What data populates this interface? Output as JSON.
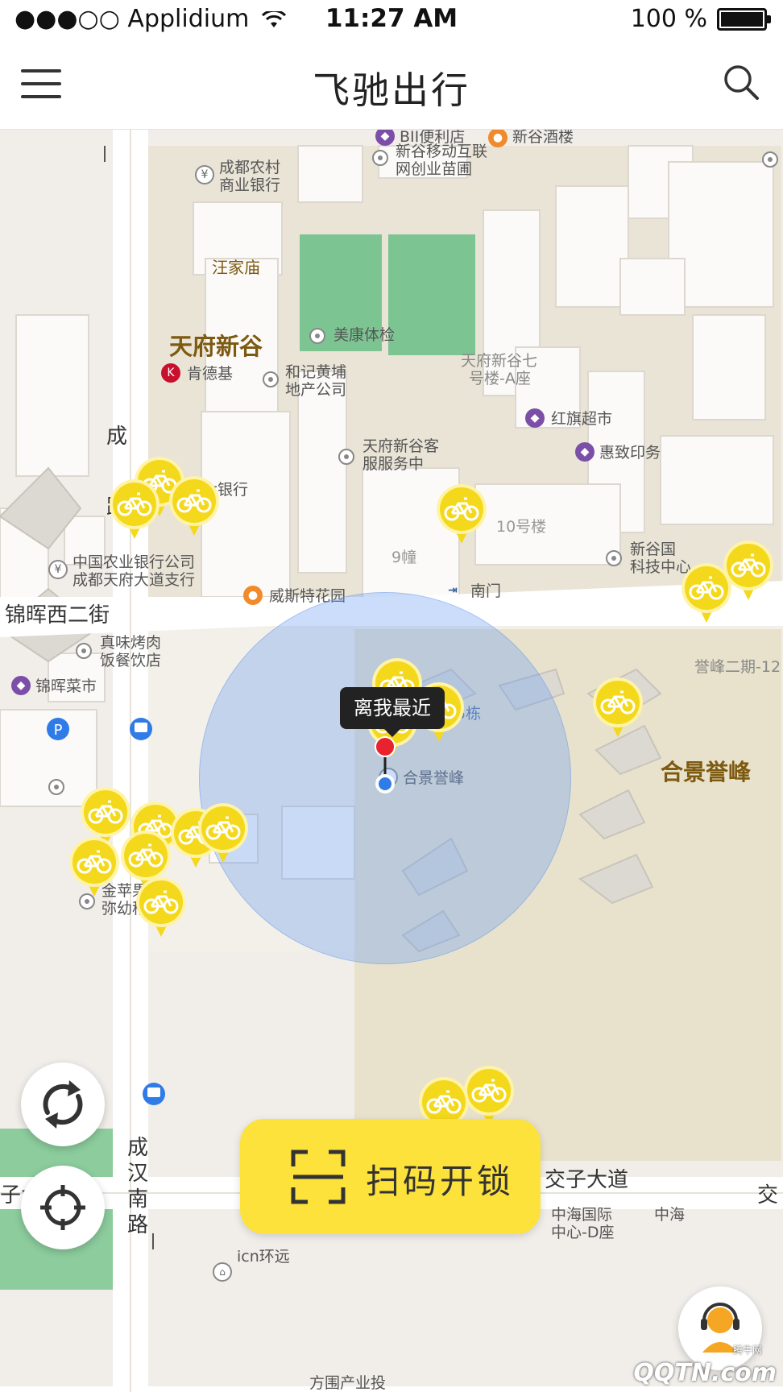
{
  "status_bar": {
    "carrier": "●●●○○ Applidium",
    "time": "11:27 AM",
    "battery_text": "100 %"
  },
  "nav": {
    "title": "飞驰出行"
  },
  "map": {
    "area_labels": {
      "tianfu_xingu": "天府新谷",
      "hejing_yufeng": "合景誉峰",
      "wangjiamiao": "汪家庙"
    },
    "roads": {
      "jinhui_west": "锦晖西二街",
      "jiaozi_avenue": "交子大道",
      "chenghan_south_1": "成",
      "chenghan_south_2": "汉",
      "chenghan_south_3": "南",
      "chenghan_south_4": "路",
      "left_fragment": "子大",
      "right_fragment": "交",
      "cheng_fragment": "成",
      "lu_fragment": "路"
    },
    "pois": {
      "bii_store": "BII便利店",
      "xingu_hotel": "新谷酒楼",
      "xingu_mobile_1": "新谷移动互联",
      "xingu_mobile_2": "网创业苗圃",
      "rural_bank_1": "成都农村",
      "rural_bank_2": "商业银行",
      "meikang": "美康体检",
      "kfc": "肯德基",
      "heji_1": "和记黄埔",
      "heji_2": "地产公司",
      "building7_1": "天府新谷七",
      "building7_2": "号楼-A座",
      "hongqi": "红旗超市",
      "huizhi": "惠致印务",
      "service_1": "天府新谷客",
      "service_2": "服服务中",
      "everbright": "光大银行",
      "building10": "10号楼",
      "tech_1": "新谷国",
      "tech_2": "科技中心",
      "building9": "9幢",
      "abc_1": "中国农业银行公司",
      "abc_2": "成都天府大道支行",
      "venice": "威斯特花园",
      "south_gate": "南门",
      "restaurant_1": "真味烤肉",
      "restaurant_2": "饭餐饮店",
      "jinhui_market": "锦晖菜市",
      "yufeng_phase2": "誉峰二期-12",
      "yufeng_building5": "誉峰二期5栋",
      "hejing_poi": "合景誉峰",
      "kindergarten_1": "金苹果爱",
      "kindergarten_2": "弥幼稚园",
      "icn": "icn环远",
      "zhonghai_1": "中海国际",
      "zhonghai_2": "中心-D座",
      "zhonghai_right": "中海",
      "fangwei": "方围产业投"
    },
    "tooltip": "离我最近",
    "bike_count": 19
  },
  "actions": {
    "scan_unlock": "扫码开锁"
  },
  "watermark": {
    "brand": "QQTN.com",
    "site": "腾牛网"
  },
  "colors": {
    "accent_yellow": "#fde23c",
    "bike_yellow": "#f4d81c",
    "location_blue": "#2f7be8",
    "pin_red": "#e8232d",
    "park_green": "#7cc593"
  }
}
